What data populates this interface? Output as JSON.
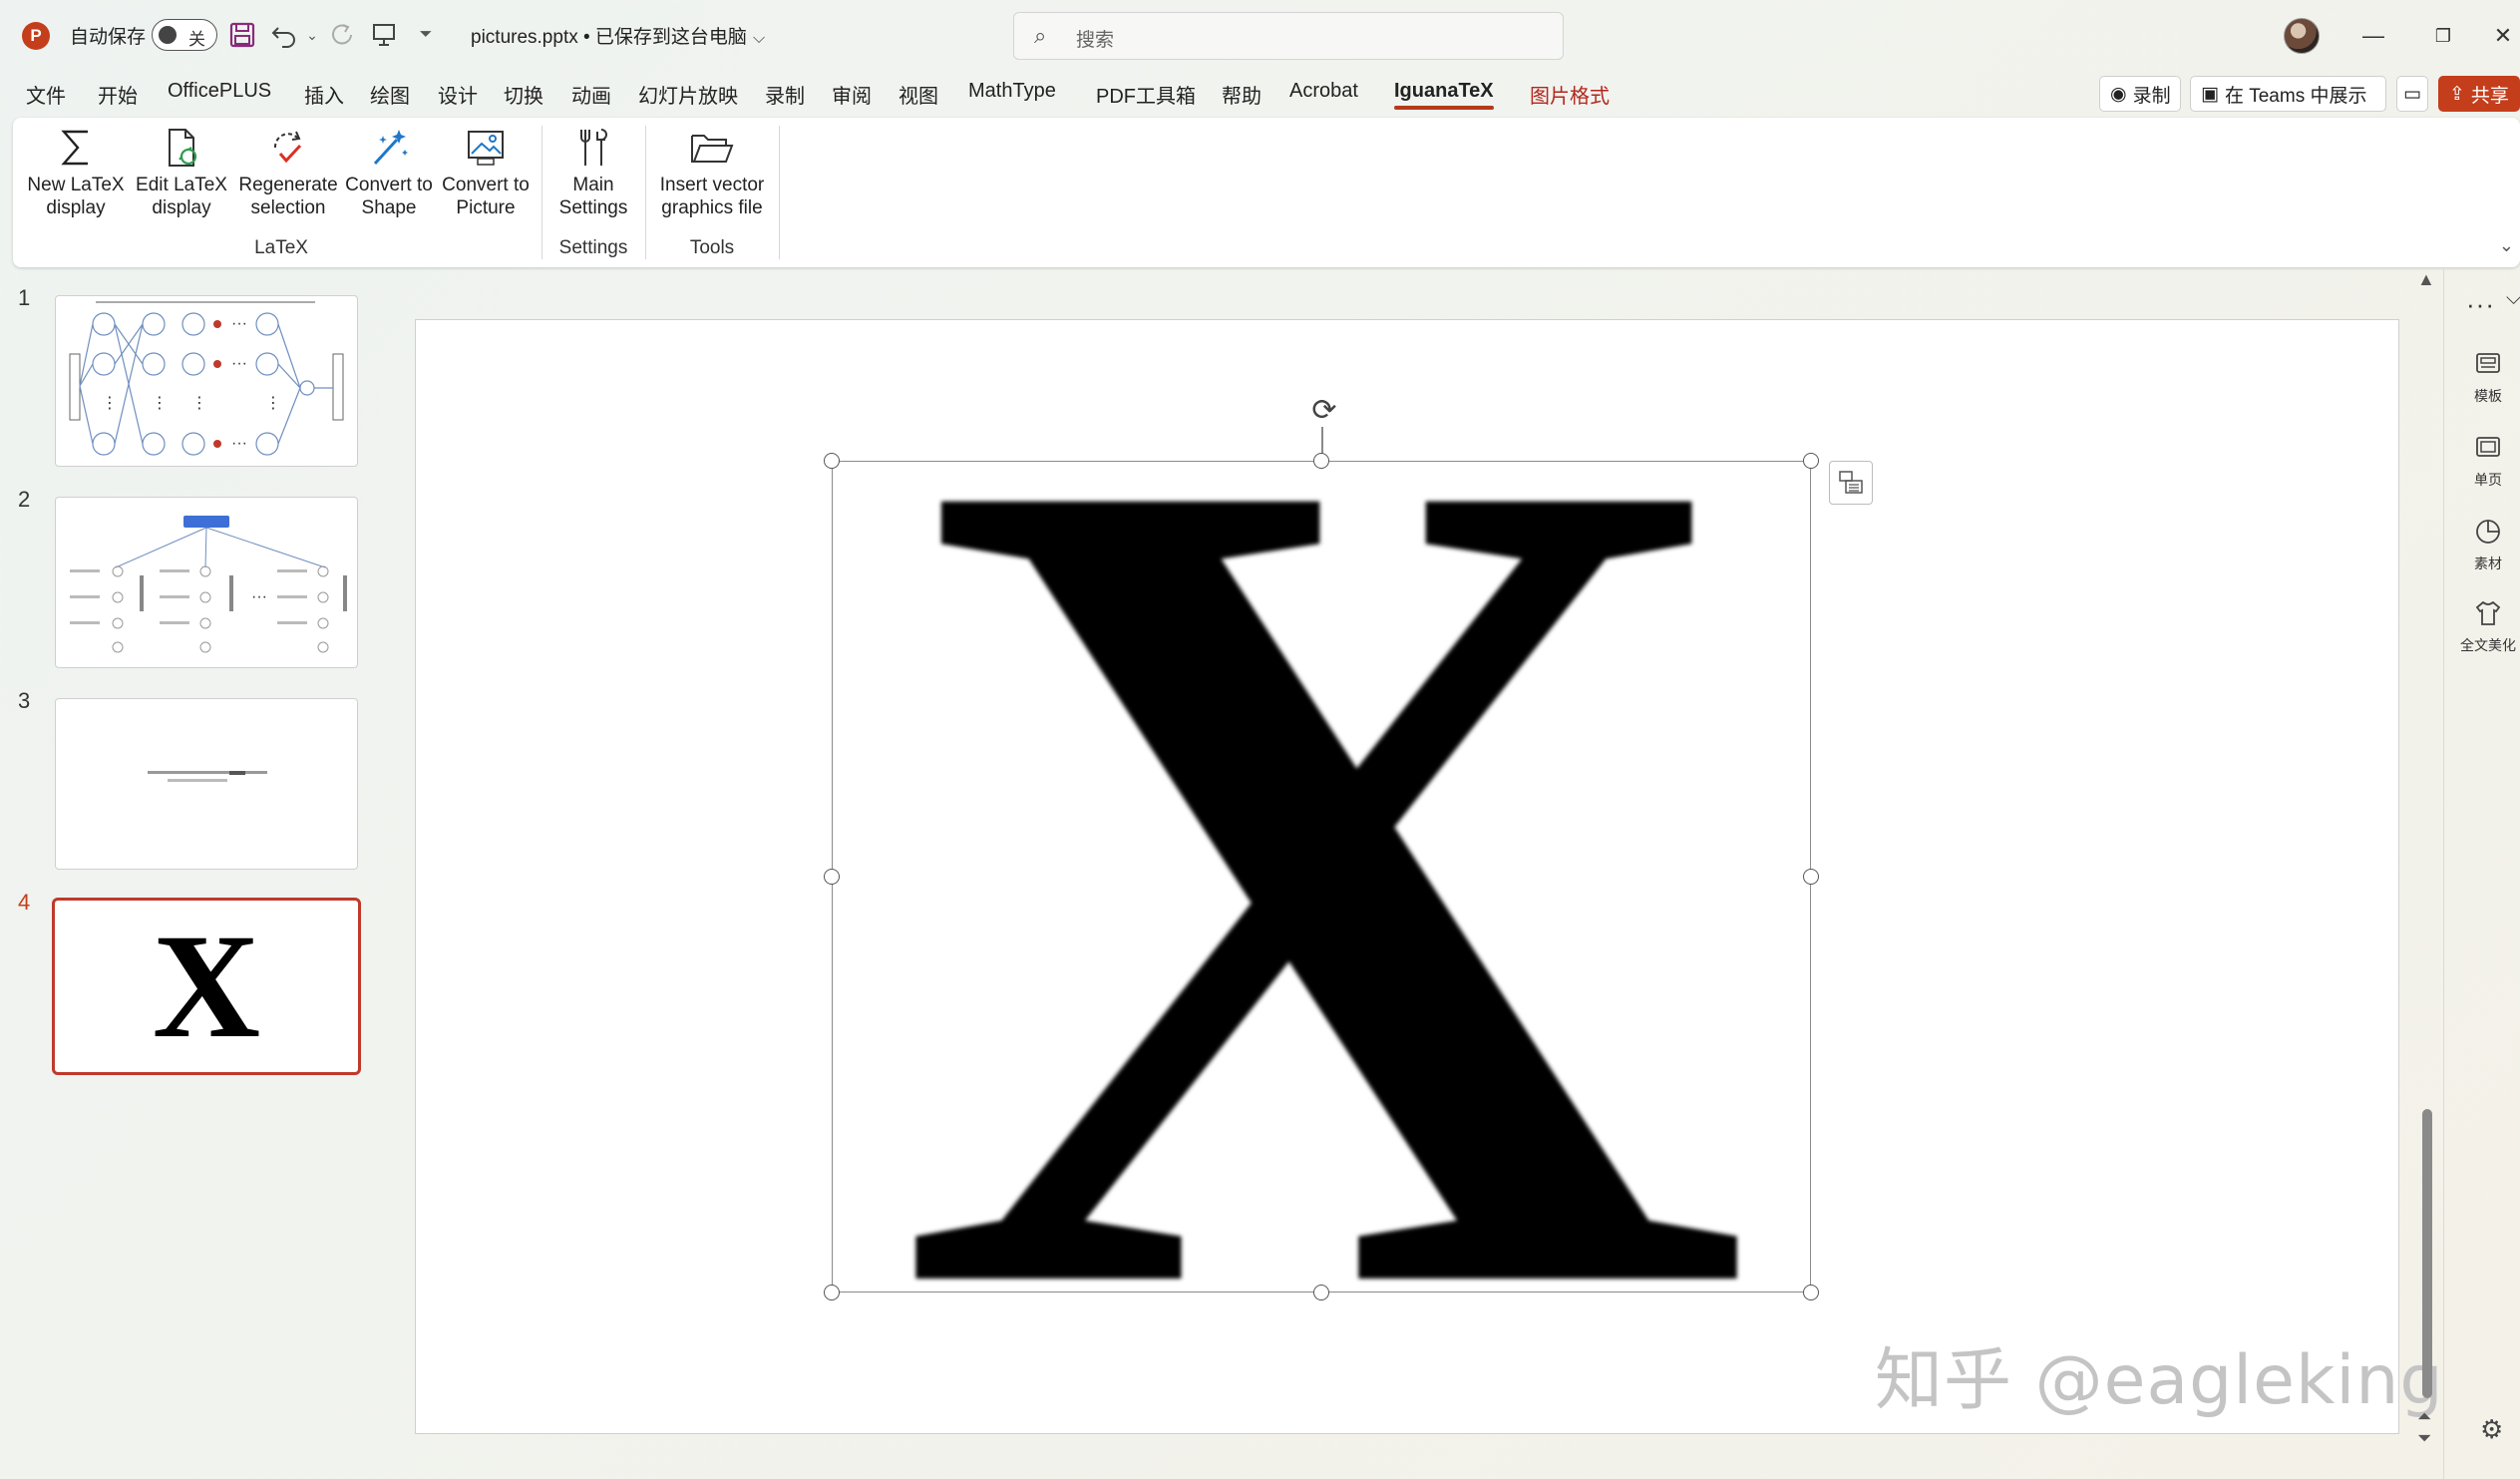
{
  "titlebar": {
    "app_logo": "P",
    "autosave_label": "自动保存",
    "autosave_state": "关",
    "doc_title": "pictures.pptx • 已保存到这台电脑",
    "search_placeholder": "搜索"
  },
  "menu": {
    "tabs": [
      "文件",
      "开始",
      "OfficePLUS",
      "插入",
      "绘图",
      "设计",
      "切换",
      "动画",
      "幻灯片放映",
      "录制",
      "审阅",
      "视图",
      "MathType",
      "PDF工具箱",
      "帮助",
      "Acrobat",
      "IguanaTeX",
      "图片格式"
    ],
    "active_tab": "IguanaTeX",
    "record_label": "录制",
    "teams_label": "在 Teams 中展示",
    "share_label": "共享"
  },
  "ribbon": {
    "buttons": {
      "new_latex": "New LaTeX display",
      "edit_latex": "Edit LaTeX display",
      "regenerate": "Regenerate selection",
      "to_shape": "Convert to Shape",
      "to_picture": "Convert to Picture",
      "main_settings": "Main Settings",
      "insert_vector": "Insert vector graphics file"
    },
    "groups": {
      "latex": "LaTeX",
      "settings": "Settings",
      "tools": "Tools"
    }
  },
  "thumbnails": {
    "numbers": [
      "1",
      "2",
      "3",
      "4"
    ],
    "active_index": 4,
    "slide4_text": "X"
  },
  "slide": {
    "picture_text": "X",
    "watermark": "知乎 @eagleking"
  },
  "sidepane": {
    "items": [
      "模板",
      "单页",
      "素材",
      "全文美化"
    ]
  },
  "colors": {
    "accent": "#c43e1c",
    "active_slide_border": "#c0392b",
    "contextual_tab": "#b3261e"
  }
}
